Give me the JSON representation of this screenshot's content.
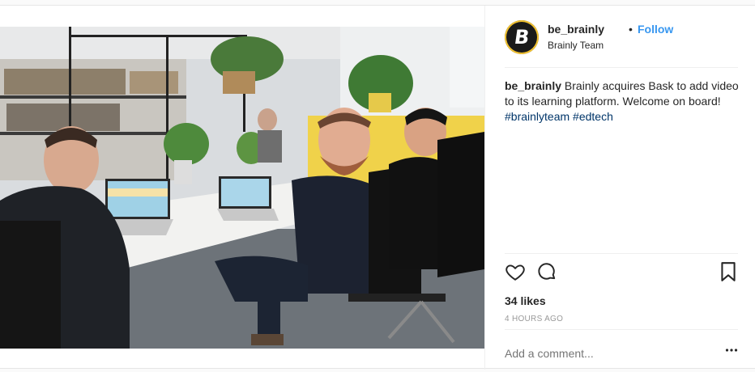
{
  "post": {
    "photo_alt": "Photo",
    "username": "be_brainly",
    "dot": "•",
    "follow_label": "Follow",
    "subtitle": "Brainly Team",
    "avatar_letter": "B",
    "caption": {
      "username": "be_brainly",
      "text": " Brainly acquires Bask to add video to its learning platform. Welcome on board! ",
      "tags": [
        "#brainlyteam",
        "#edtech"
      ]
    },
    "likes": "34 likes",
    "time": "4 HOURS AGO",
    "comment_placeholder": "Add a comment...",
    "icons": {
      "like": "heart-icon",
      "comment": "comment-icon",
      "save": "bookmark-icon",
      "more": "more-options-icon"
    },
    "colors": {
      "link": "#3897f0",
      "hashtag": "#003569",
      "muted": "#999999",
      "text": "#262626"
    }
  }
}
